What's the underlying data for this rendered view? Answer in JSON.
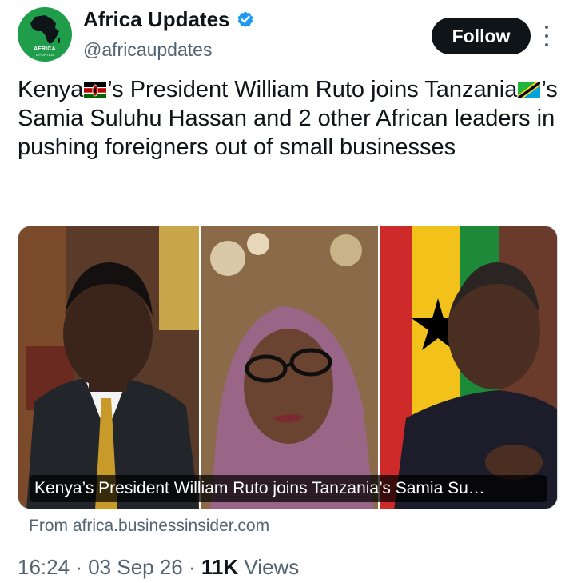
{
  "account": {
    "display_name": "Africa Updates",
    "handle": "@africaupdates",
    "avatar_text_line1": "AFRICA",
    "avatar_text_line2": "UPDATES",
    "verified": true,
    "verified_icon": "verified-badge-icon",
    "accent_color": "#1d9bf0"
  },
  "actions": {
    "follow_label": "Follow",
    "more_icon": "more-vertical-icon"
  },
  "tweet": {
    "text_part1": "Kenya",
    "flag1": "kenya-flag-icon",
    "text_part2": "’s President William Ruto joins Tanzania",
    "flag2": "tanzania-flag-icon",
    "text_part3": "’s Samia Suluhu Hassan and 2 other African leaders in pushing foreigners out of small businesses"
  },
  "card": {
    "caption": "Kenya’s President William Ruto joins Tanzania’s Samia Su…",
    "source": "From africa.businessinsider.com"
  },
  "meta": {
    "time": "16:24",
    "separator": "·",
    "date": "03 Sep 26",
    "views_count": "11K",
    "views_label": "Views"
  }
}
